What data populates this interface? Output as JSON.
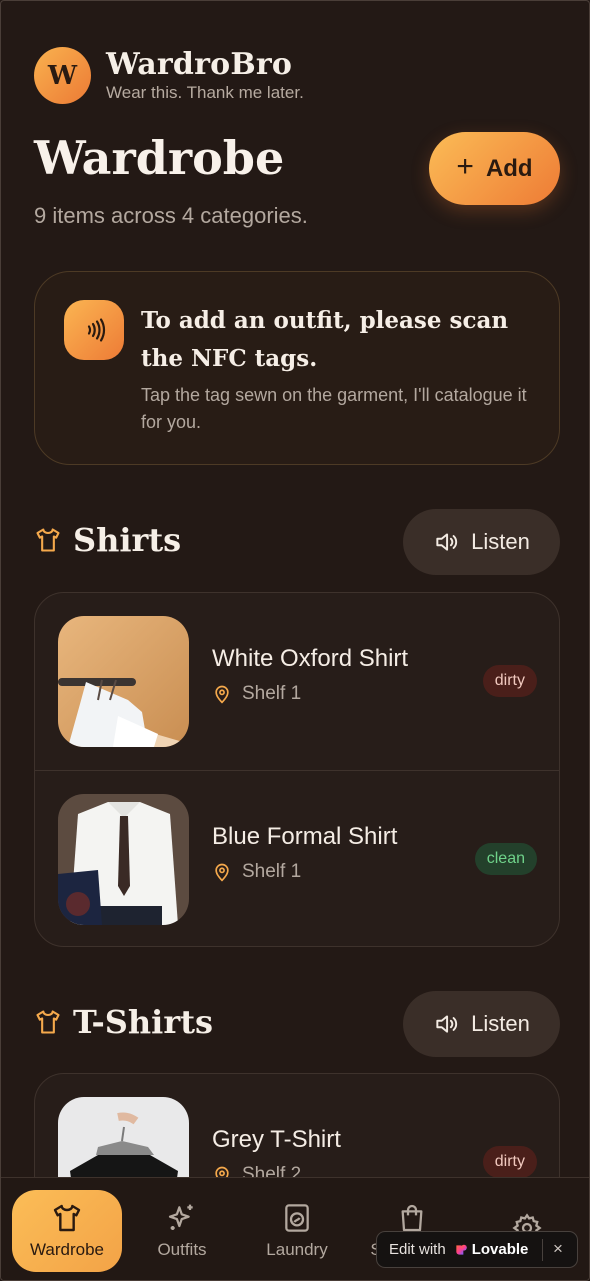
{
  "brand": {
    "logo_letter": "W",
    "name": "WardroBro",
    "tagline": "Wear this. Thank me later."
  },
  "page": {
    "title": "Wardrobe",
    "subtitle": "9 items across 4 categories.",
    "add_label": "Add"
  },
  "nfc": {
    "title": "To add an outfit, please scan the NFC tags.",
    "description": "Tap the tag sewn on the garment, I'll catalogue it for you."
  },
  "sections": [
    {
      "title": "Shirts",
      "listen_label": "Listen",
      "items": [
        {
          "name": "White Oxford Shirt",
          "location": "Shelf 1",
          "status": "dirty"
        },
        {
          "name": "Blue Formal Shirt",
          "location": "Shelf 1",
          "status": "clean"
        }
      ]
    },
    {
      "title": "T-Shirts",
      "listen_label": "Listen",
      "items": [
        {
          "name": "Grey T-Shirt",
          "location": "Shelf 2",
          "status": "dirty"
        }
      ]
    }
  ],
  "nav": {
    "items": [
      {
        "label": "Wardrobe",
        "icon": "shirt-icon",
        "active": true
      },
      {
        "label": "Outfits",
        "icon": "sparkles-icon",
        "active": false
      },
      {
        "label": "Laundry",
        "icon": "washing-machine-icon",
        "active": false
      },
      {
        "label": "S",
        "icon": "shopping-bag-icon",
        "active": false
      },
      {
        "label": "",
        "icon": "gear-icon",
        "active": false
      }
    ]
  },
  "lovable": {
    "prefix": "Edit with",
    "brand": "Lovable",
    "close": "×"
  },
  "colors": {
    "background": "#231915",
    "accent_start": "#fbbc56",
    "accent_end": "#ee7b35",
    "dirty_badge": "#4a1f1a",
    "clean_badge": "#23402b"
  }
}
